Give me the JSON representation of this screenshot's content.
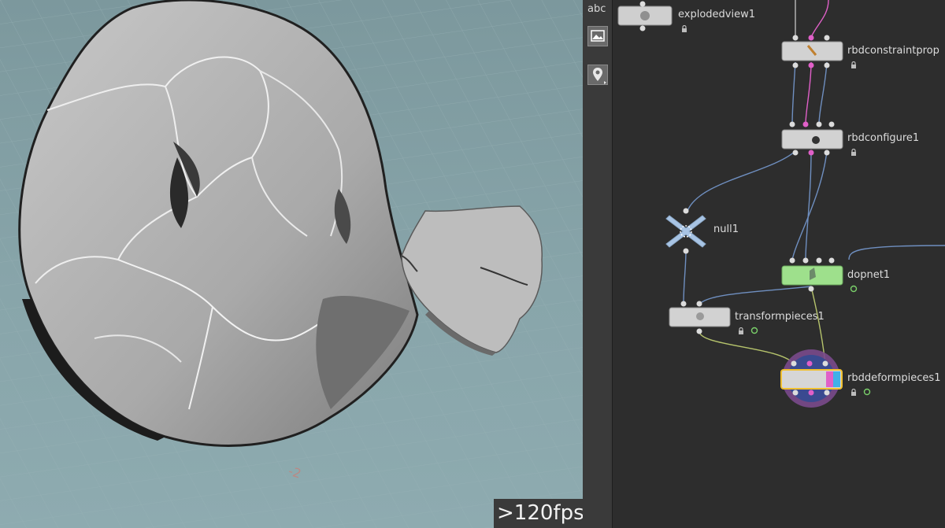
{
  "viewport": {
    "grid_label": "-2",
    "fps": ">120fps",
    "info_icon": "info-icon"
  },
  "toolbar": {
    "label": "abc",
    "buttons": [
      {
        "icon": "image-icon"
      },
      {
        "icon": "map-pin-icon"
      }
    ]
  },
  "network": {
    "nodes": [
      {
        "id": "explodedview1",
        "label": "explodedview1"
      },
      {
        "id": "rbdconstraintprop",
        "label": "rbdconstraintprop"
      },
      {
        "id": "rbdconfigure1",
        "label": "rbdconfigure1"
      },
      {
        "id": "null1",
        "label": "null1"
      },
      {
        "id": "dopnet1",
        "label": "dopnet1"
      },
      {
        "id": "transformpieces1",
        "label": "transformpieces1"
      },
      {
        "id": "rbddeformpieces1",
        "label": "rbddeformpieces1"
      }
    ],
    "colors": {
      "wire_blue": "#6f8fc0",
      "wire_pink": "#e060c8",
      "wire_green": "#b6c46c",
      "node_green": "#9ee08c",
      "selected": "#f0c030"
    }
  }
}
